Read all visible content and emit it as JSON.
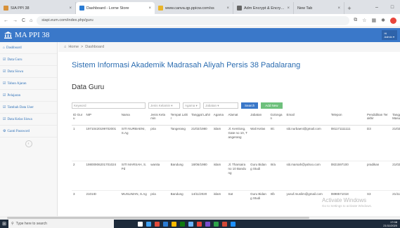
{
  "browser": {
    "tabs": [
      {
        "title": "SIA PPI 38",
        "fav_color": "#d7913a"
      },
      {
        "title": "Dashboard - Lorne Store",
        "fav_color": "#2b7cd3"
      },
      {
        "title": "www.canva.qp.ppicw.com/ss",
        "fav_color": "#e9b42a"
      },
      {
        "title": "Adm Encrypt & Encrypt - Mon",
        "fav_color": "#666666"
      },
      {
        "title": "New Tab",
        "fav_color": "#ffffff"
      }
    ],
    "url": "siapi.eum.com/index.php/guru",
    "nav": {
      "back": "←",
      "forward": "→",
      "reload": "C",
      "home": "⌂"
    }
  },
  "app": {
    "brand": "MA PPI 38",
    "brand_icon": "bank-icon",
    "user_line1": "Hi",
    "user_line2": "Admin"
  },
  "sidebar": {
    "items": [
      {
        "label": "Dashboard",
        "icon": "⌂"
      },
      {
        "label": "Data Guru",
        "icon": "☑"
      },
      {
        "label": "Data Siswa",
        "icon": "☑"
      },
      {
        "label": "Tahun Ajaran",
        "icon": "☑"
      },
      {
        "label": "Pelajaran",
        "icon": "☑"
      },
      {
        "label": "Tambah Data User",
        "icon": "☑"
      },
      {
        "label": "Data Kelas Siswa",
        "icon": "☑"
      },
      {
        "label": "Ganti Password",
        "icon": "⚙"
      }
    ],
    "toggle": "‹"
  },
  "main": {
    "breadcrumb_home": "Home",
    "breadcrumb_sep": ">",
    "breadcrumb_current": "Dashboard",
    "page_title": "Sistem Informasi Akademik Madrasah Aliyah Persis 38 Padalarang",
    "section_title": "Data Guru",
    "filters": {
      "keyword": "Keyword",
      "jenis_kelamin": "Jenis Kelamin",
      "agama": "Agama",
      "jabatan": "Jabatan",
      "search_btn": "Search",
      "add_btn": "Add New"
    },
    "table": {
      "headers": [
        "ID Guru",
        "NIP",
        "Nama",
        "Jenis Kelamin",
        "Tempat Lahir",
        "Tanggal Lahir",
        "Agama",
        "Alamat",
        "Jabatan",
        "Golongan",
        "Email",
        "Telepon",
        "Pendidikan Terakhir",
        "Tanggal Masuk"
      ],
      "rows": [
        [
          "1",
          "19710420199702001",
          "SITI NURBAENI, S.Ag",
          "pria",
          "Tangerang",
          "21/02/1980",
          "islam",
          "Jl. Kemlong, Gate no 10, Tangerang",
          "Wali Kelas",
          "II/c",
          "siti.nurbaeni@gmail.com",
          "081171111111",
          "D3",
          "21/02/"
        ],
        [
          "2",
          "19800906201701024",
          "SITI MARSAH, S.Pd",
          "wanita",
          "Bandung",
          "18/06/1980",
          "islam",
          "Jl. Tharsaira no 10 Bandung",
          "Guru Bidang Studi",
          "III/a",
          "siti.marsah@yahoo.com",
          "0821597100",
          "pradikan",
          "21/02/"
        ],
        [
          "3",
          "2101ID",
          "MUSLIMAN, S.Ag",
          "pria",
          "Bandung",
          "14/11/2020",
          "islam",
          "Sat",
          "Guru Bidang Studi",
          "II/b",
          "yusuf.muslim@gmail.com",
          "0898571018",
          "S3",
          "21/11/"
        ]
      ]
    }
  },
  "watermark": {
    "line1": "Activate Windows",
    "line2": "Go to Settings to activate Windows."
  },
  "taskbar": {
    "search_placeholder": "Type here to search",
    "time": "17:08",
    "date": "21/11/2020",
    "icon_colors": [
      "#ffffff",
      "#3fa2f5",
      "#e24c3c",
      "#2b7cd3",
      "#ffb900",
      "#0f7b0f",
      "#6bb4ff",
      "#e8453c",
      "#7a4ecf",
      "#2ea34a",
      "#d14836",
      "#1e90ff"
    ]
  }
}
